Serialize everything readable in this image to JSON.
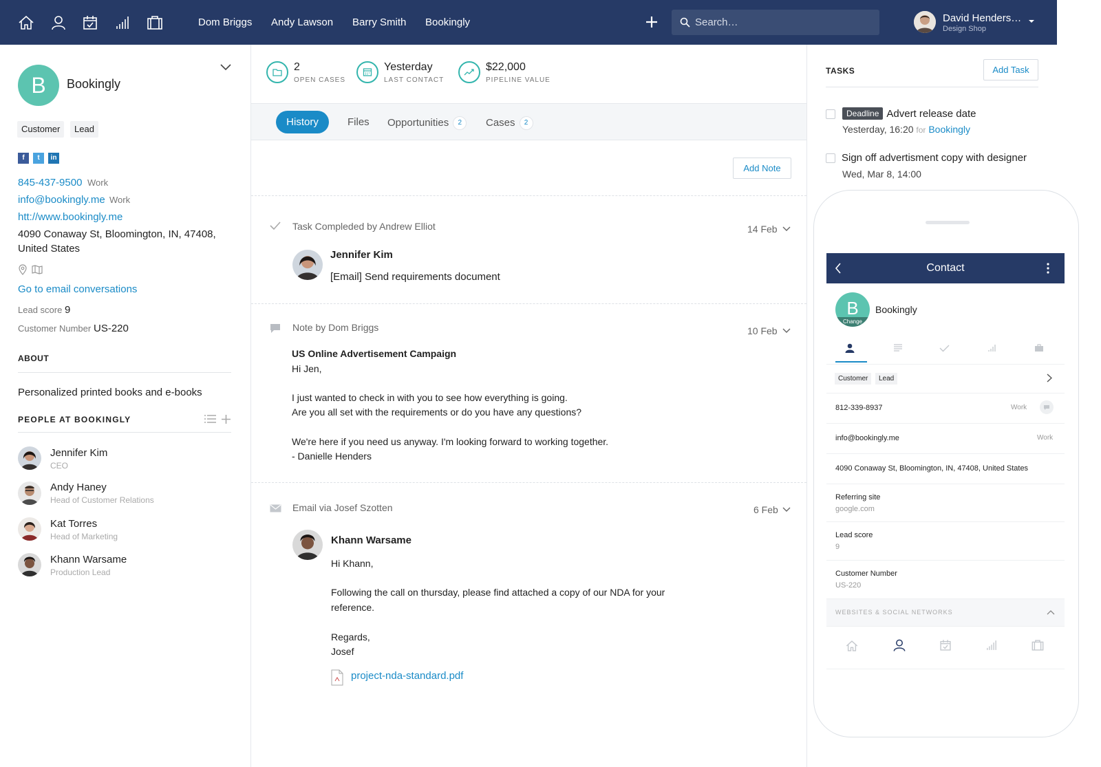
{
  "topnav": {
    "icons": [
      "home-icon",
      "person-icon",
      "calendar-icon",
      "bars-icon",
      "briefcase-icon"
    ],
    "links": [
      "Dom Briggs",
      "Andy Lawson",
      "Barry Smith",
      "Bookingly"
    ],
    "search_placeholder": "Search…",
    "user_name": "David Henders…",
    "user_sub": "Design Shop"
  },
  "contact": {
    "initial": "B",
    "name": "Bookingly",
    "tags": [
      "Customer",
      "Lead"
    ],
    "social": [
      "f",
      "t",
      "in"
    ],
    "phone": "845-437-9500",
    "phone_type": "Work",
    "email": "info@bookingly.me",
    "email_type": "Work",
    "website": "htt://www.bookingly.me",
    "address_line1": "4090 Conaway St, Bloomington, IN, 47408,",
    "address_line2": "United States",
    "email_conversations": "Go to email conversations",
    "lead_score_label": "Lead score",
    "lead_score": "9",
    "customer_number_label": "Customer Number",
    "customer_number": "US-220",
    "about_title": "ABOUT",
    "about_text": "Personalized printed books and e-books",
    "people_title": "PEOPLE AT BOOKINGLY",
    "people": [
      {
        "name": "Jennifer Kim",
        "role": "CEO"
      },
      {
        "name": "Andy Haney",
        "role": "Head of Customer Relations"
      },
      {
        "name": "Kat Torres",
        "role": "Head of Marketing"
      },
      {
        "name": "Khann Warsame",
        "role": "Production Lead"
      }
    ]
  },
  "kpis": [
    {
      "value": "2",
      "label": "OPEN CASES"
    },
    {
      "value": "Yesterday",
      "label": "LAST CONTACT"
    },
    {
      "value": "$22,000",
      "label": "PIPELINE VALUE"
    }
  ],
  "tabs": {
    "history": "History",
    "files": "Files",
    "opportunities": "Opportunities",
    "opportunities_count": "2",
    "cases": "Cases",
    "cases_count": "2"
  },
  "add_note": "Add Note",
  "history": {
    "task": {
      "header": "Task Compleded by Andrew Elliot",
      "date": "14 Feb",
      "person": "Jennifer Kim",
      "text": "[Email] Send requirements document"
    },
    "note": {
      "header": "Note by Dom Briggs",
      "date": "10 Feb",
      "subject": "US Online Advertisement Campaign",
      "lines": [
        "Hi Jen,",
        "I just wanted to check in with you to see how everything is going.",
        "Are you all set with the requirements or do you have any questions?",
        "We're here if you need us anyway. I'm looking forward to working together.",
        "- Danielle Henders"
      ]
    },
    "email": {
      "header": "Email via Josef Szotten",
      "date": "6 Feb",
      "person": "Khann Warsame",
      "lines": [
        "Hi Khann,",
        "Following the call on thursday, please find attached a copy of our NDA for your",
        "reference.",
        "Regards,",
        "Josef"
      ],
      "attachment": "project-nda-standard.pdf"
    }
  },
  "tasks": {
    "title": "TASKS",
    "add_button": "Add Task",
    "items": [
      {
        "badge": "Deadline",
        "title": "Advert release date",
        "when": "Yesterday, 16:20",
        "for_label": "for",
        "for_link": "Bookingly"
      },
      {
        "title": "Sign off advertisment copy with designer",
        "when": "Wed, Mar 8, 14:00"
      }
    ]
  },
  "phone": {
    "header_title": "Contact",
    "initial": "B",
    "change_label": "Change",
    "name": "Bookingly",
    "tags": [
      "Customer",
      "Lead"
    ],
    "phone": "812-339-8937",
    "phone_type": "Work",
    "email": "info@bookingly.me",
    "email_type": "Work",
    "address": "4090 Conaway St, Bloomington, IN, 47408, United States",
    "referring_label": "Referring site",
    "referring_value": "google.com",
    "lead_score_label": "Lead score",
    "lead_score": "9",
    "customer_number_label": "Customer Number",
    "customer_number": "US-220",
    "websites_label": "WEBSITES & SOCIAL NETWORKS"
  },
  "colors": {
    "navy": "#263a66",
    "teal": "#5cc4b0",
    "link": "#1a8bc7"
  }
}
